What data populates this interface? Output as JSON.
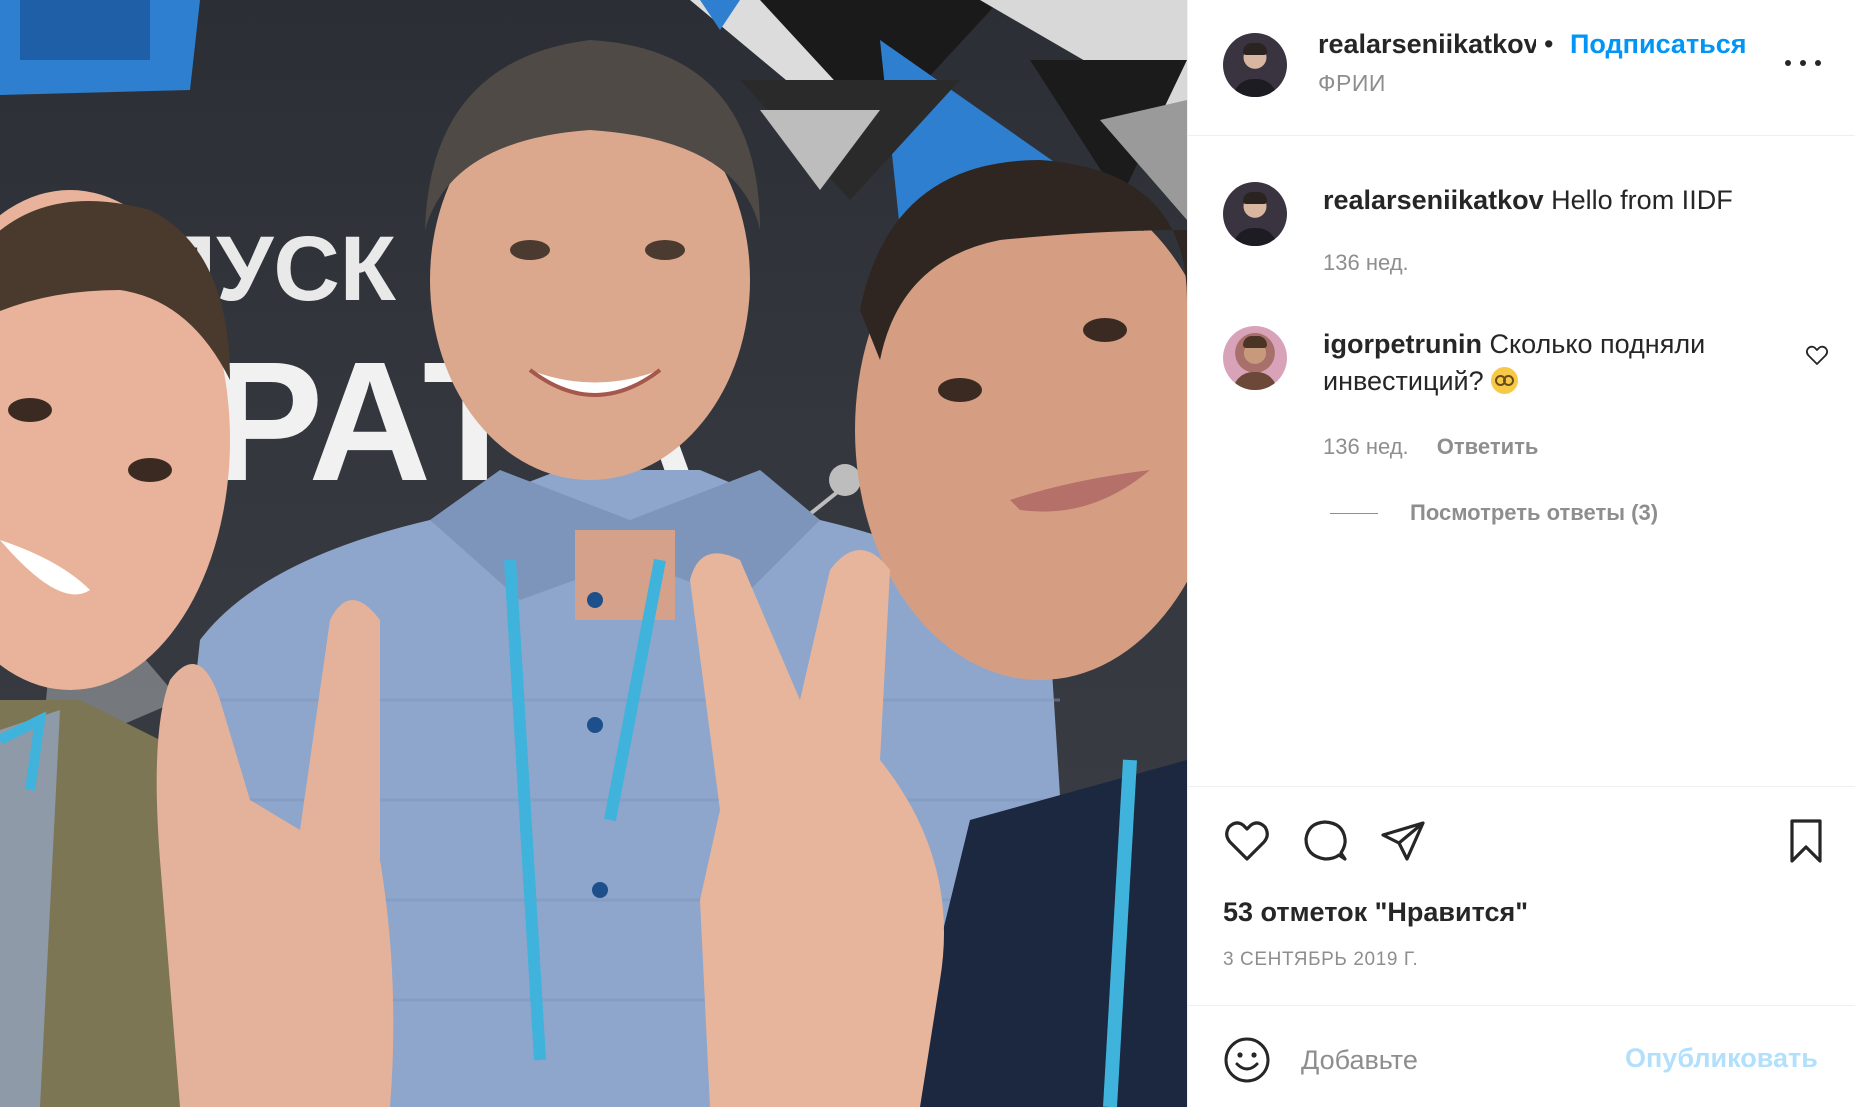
{
  "post": {
    "username": "realarseniikatkov",
    "follow_label": "Подписаться",
    "location": "ФРИИ",
    "photo_text_line1": "ПУСК",
    "photo_text_line2": "РАТ А"
  },
  "caption": {
    "username": "realarseniikatkov",
    "text": "Hello from IIDF",
    "time": "136 нед."
  },
  "comments": [
    {
      "username": "igorpetrunin",
      "text": "Сколько подняли инвестиций?",
      "emoji_icon": "nerd-face-emoji",
      "time": "136 нед.",
      "reply_label": "Ответить",
      "view_replies_label": "Посмотреть ответы (3)"
    }
  ],
  "actions": {
    "icons": [
      "heart-icon",
      "comment-icon",
      "share-icon",
      "bookmark-icon"
    ],
    "likes_text": "53 отметок \"Нравится\"",
    "date": "3 СЕНТЯБРЬ 2019 Г."
  },
  "add_comment": {
    "emoji_icon": "smiley-icon",
    "placeholder": "Добавьте",
    "publish_label": "Опубликовать"
  },
  "colors": {
    "accent": "#0095f6",
    "accent_disabled": "#b2dffc",
    "muted": "#8e8e8e",
    "text": "#262626"
  }
}
